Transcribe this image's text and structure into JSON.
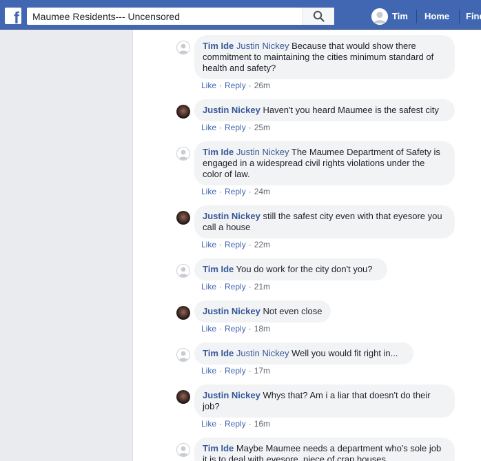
{
  "header": {
    "logo": "f",
    "search_value": "Maumee Residents--- Uncensored",
    "profile_name": "Tim",
    "nav_home": "Home",
    "nav_find": "Find"
  },
  "actions": {
    "like": "Like",
    "reply": "Reply",
    "separator": "·"
  },
  "comments": [
    {
      "author": "Tim Ide",
      "mention": "Justin Nickey",
      "text": "Because that would show there commitment to maintaining the cities minimum standard of health and safety?",
      "time": "26m"
    },
    {
      "author": "Justin Nickey",
      "mention": "",
      "text": "Haven't you heard Maumee is the safest city",
      "time": "25m"
    },
    {
      "author": "Tim Ide",
      "mention": "Justin Nickey",
      "text": "The Maumee Department of Safety is engaged in a widespread civil rights violations under the color of law.",
      "time": "24m"
    },
    {
      "author": "Justin Nickey",
      "mention": "",
      "text": "still the safest city even with that eyesore you call a house",
      "time": "22m"
    },
    {
      "author": "Tim Ide",
      "mention": "",
      "text": "You do work for the city don't you?",
      "time": "21m"
    },
    {
      "author": "Justin Nickey",
      "mention": "",
      "text": "Not even close",
      "time": "18m"
    },
    {
      "author": "Tim Ide",
      "mention": "Justin Nickey",
      "text": "Well you would fit right in...",
      "time": "17m"
    },
    {
      "author": "Justin Nickey",
      "mention": "",
      "text": "Whys that? Am i a liar that doesn't do their job?",
      "time": "16m"
    },
    {
      "author": "Tim Ide",
      "mention": "",
      "text": "Maybe Maumee needs a department who's sole job it is to deal with eyesore, piece of crap houses",
      "time": ""
    }
  ]
}
